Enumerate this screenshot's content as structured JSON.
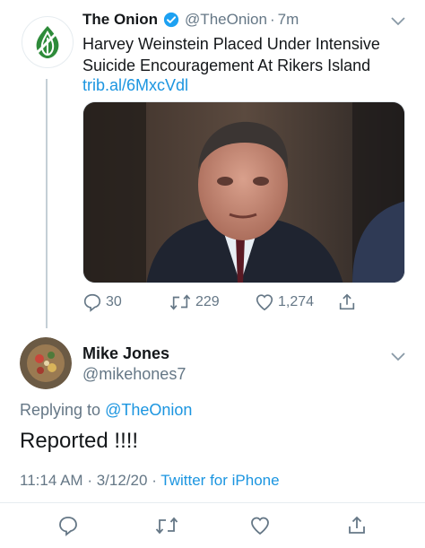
{
  "tweet": {
    "author_name": "The Onion",
    "author_handle": "@TheOnion",
    "separator": "·",
    "time": "7m",
    "text": "Harvey Weinstein Placed Under Intensive Suicide Encouragement At Rikers Island",
    "link": "trib.al/6MxcVdl",
    "replies": "30",
    "retweets": "229",
    "likes": "1,274"
  },
  "reply": {
    "author_name": "Mike Jones",
    "author_handle": "@mikehones7",
    "replying_prefix": "Replying to",
    "replying_to": "@TheOnion",
    "text": "Reported !!!!",
    "time": "11:14 AM",
    "date": "3/12/20",
    "separator": "·",
    "source": "Twitter for iPhone"
  },
  "colors": {
    "link_blue": "#1b95e0",
    "muted_gray": "#657786",
    "onion_green": "#2e8b3a"
  }
}
